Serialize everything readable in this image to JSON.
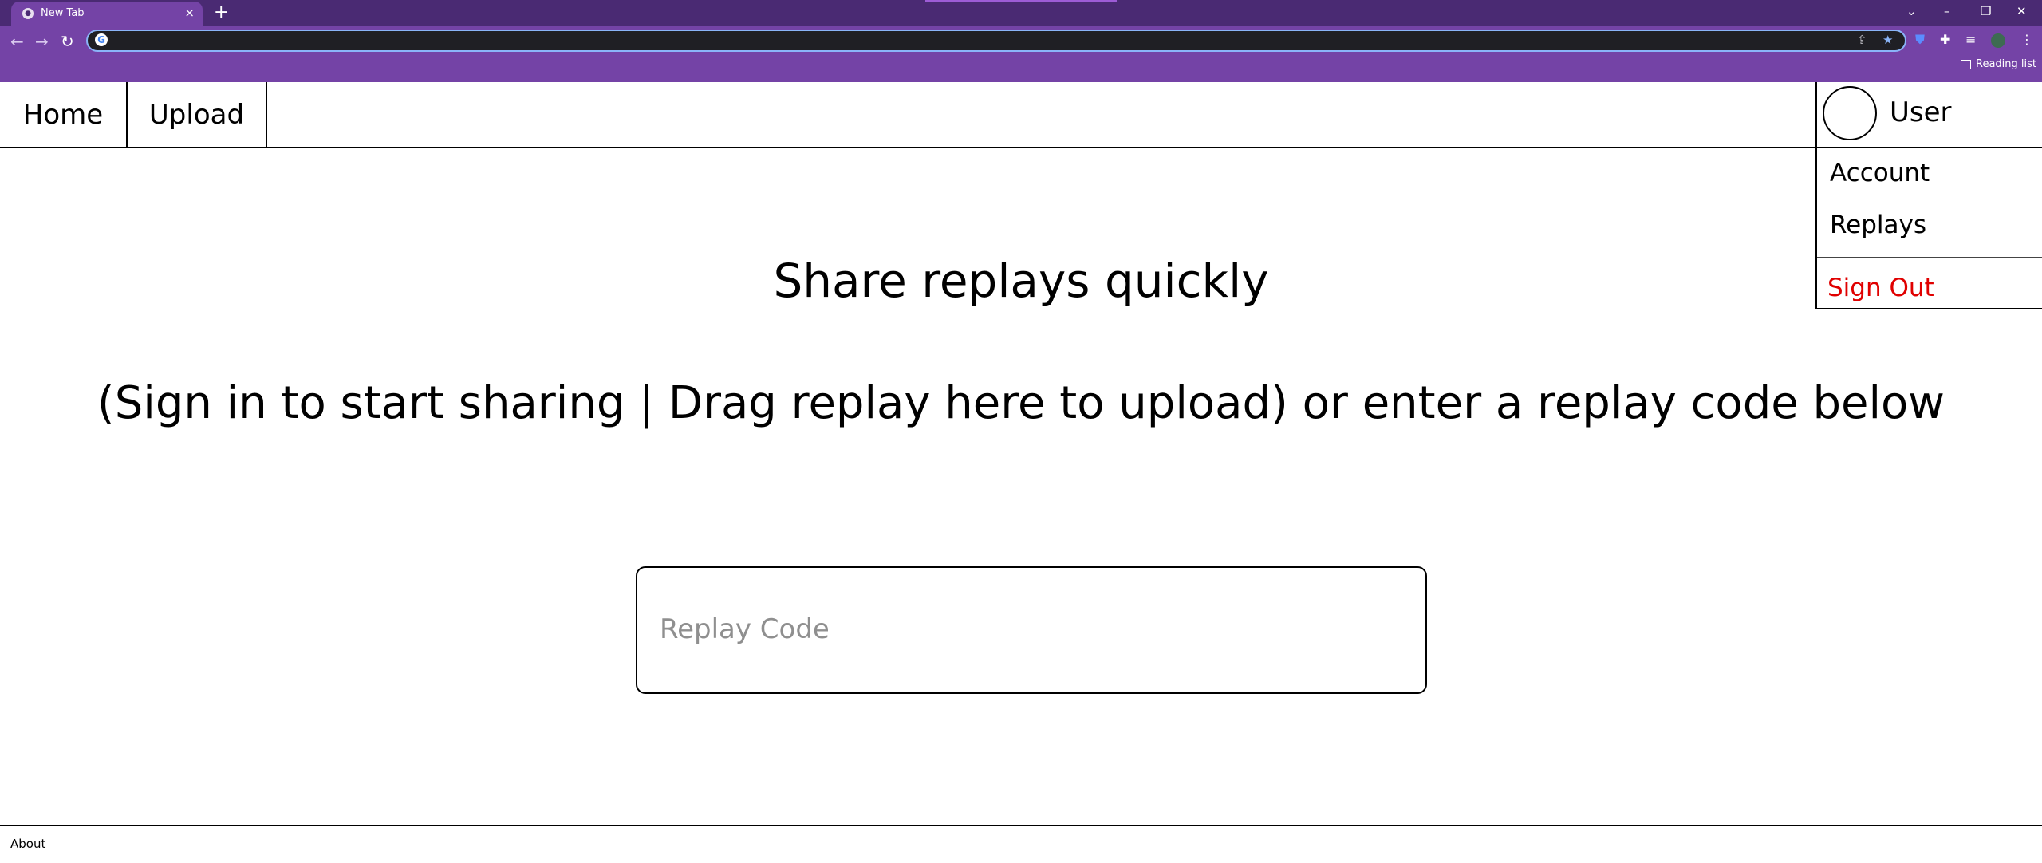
{
  "browser": {
    "tab_title": "New Tab",
    "tab_close_glyph": "×",
    "new_tab_glyph": "+",
    "omnibox_value": "",
    "reading_list": "Reading list",
    "icons": [
      "back-icon",
      "forward-icon",
      "reload-icon",
      "share-icon",
      "star-icon",
      "bitwarden-icon",
      "puzzle-icon",
      "media-icon",
      "profile-icon",
      "menu-icon"
    ],
    "colors": {
      "tabstrip": "#4a2a73",
      "toolbar": "#7443a6",
      "omnibox": "#1f1f24"
    }
  },
  "nav": {
    "home": "Home",
    "upload": "Upload",
    "user": "User"
  },
  "user_menu": {
    "account": "Account",
    "replays": "Replays",
    "sign_out": "Sign Out"
  },
  "main": {
    "headline": "Share replays quickly",
    "subline": "(Sign in to start sharing | Drag replay here to upload) or enter a replay code below",
    "code_placeholder": "Replay Code",
    "code_value": ""
  },
  "footer": {
    "about": "About"
  },
  "colors": {
    "sign_out": "#e00000",
    "border": "#000000"
  }
}
